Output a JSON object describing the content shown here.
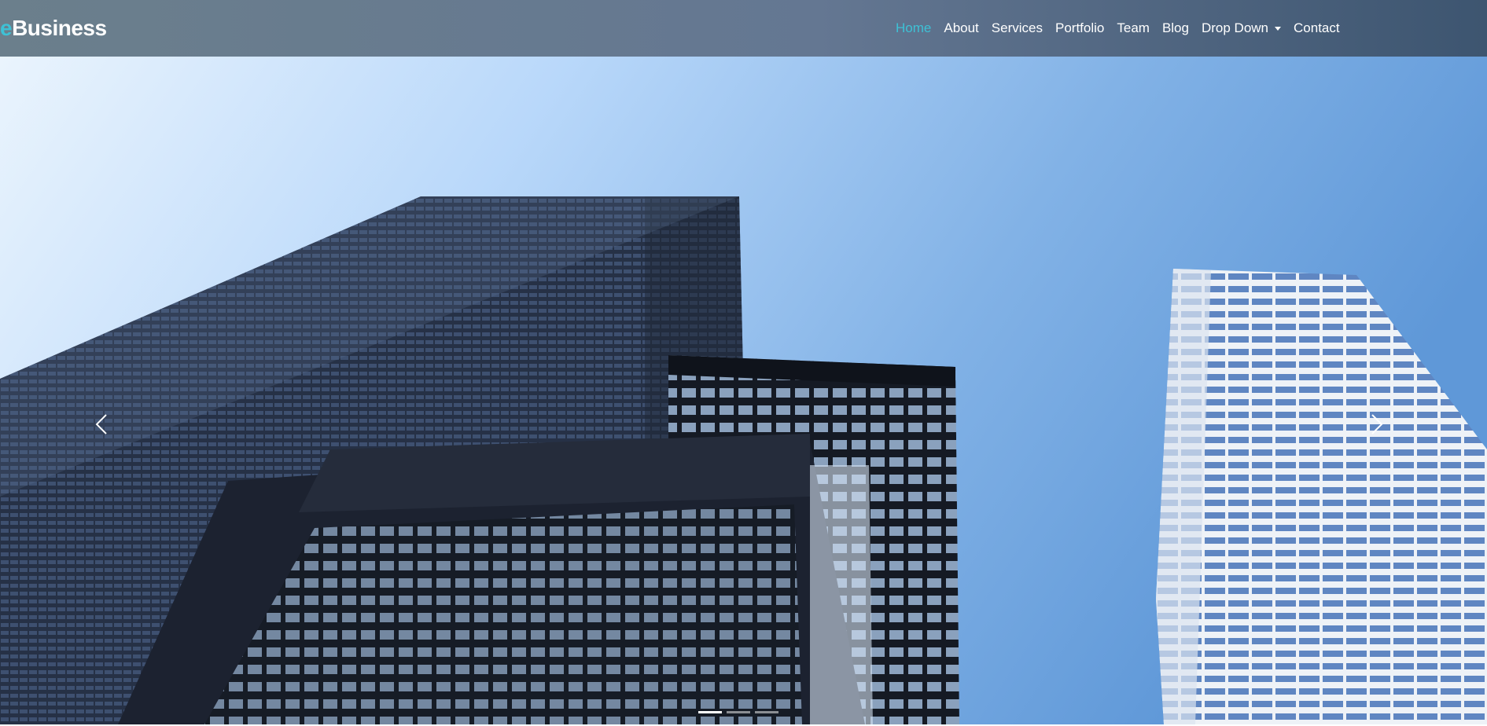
{
  "brand": {
    "accent_letter": "e",
    "rest": "Business",
    "accent_color": "#3ec1d5"
  },
  "nav": {
    "items": [
      {
        "label": "Home",
        "active": true
      },
      {
        "label": "About"
      },
      {
        "label": "Services"
      },
      {
        "label": "Portfolio"
      },
      {
        "label": "Team"
      },
      {
        "label": "Blog"
      },
      {
        "label": "Drop Down",
        "dropdown": true
      },
      {
        "label": "Contact"
      }
    ]
  },
  "carousel": {
    "prev_icon": "chevron-left-icon",
    "next_icon": "chevron-right-icon",
    "slide_count": 3,
    "active_index": 0
  }
}
